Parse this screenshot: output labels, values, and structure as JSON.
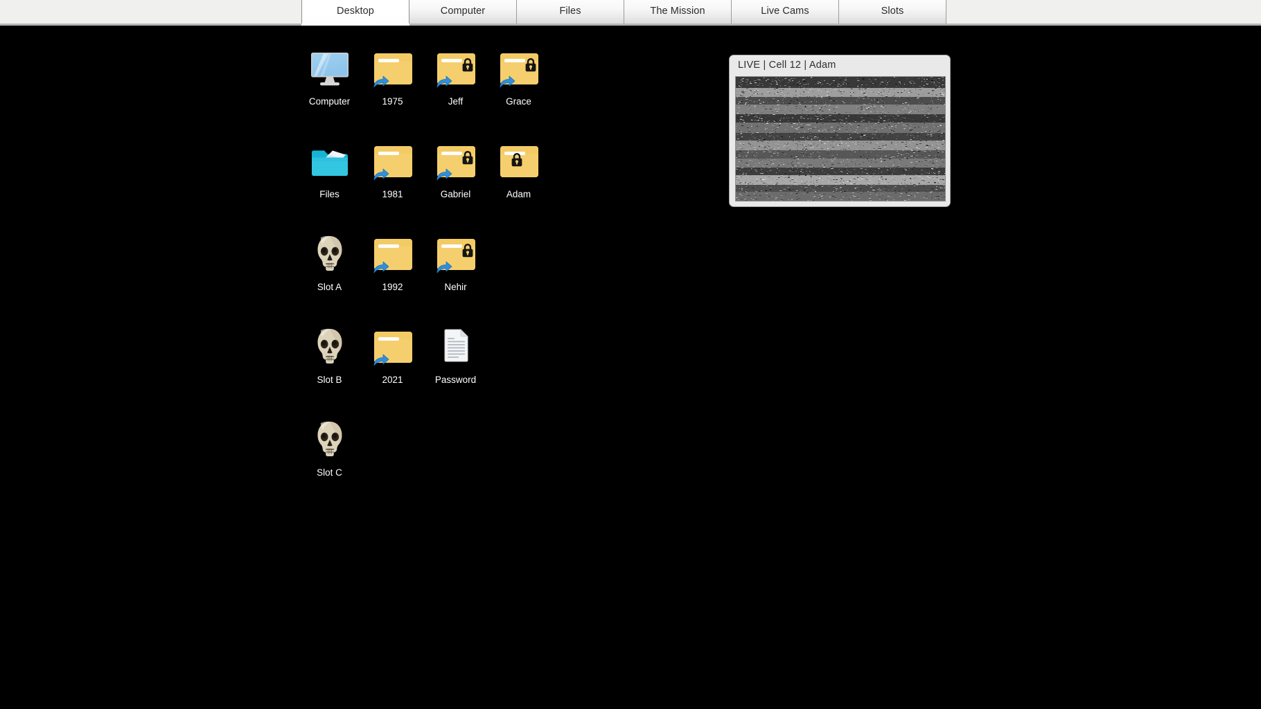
{
  "tabs": [
    {
      "label": "Desktop",
      "active": true
    },
    {
      "label": "Computer",
      "active": false
    },
    {
      "label": "Files",
      "active": false
    },
    {
      "label": "The Mission",
      "active": false
    },
    {
      "label": "Live Cams",
      "active": false
    },
    {
      "label": "Slots",
      "active": false
    }
  ],
  "desktop": {
    "background_color": "#000000",
    "label_color": "#ffffff",
    "rows": [
      [
        {
          "label": "Computer",
          "icon": "computer-monitor-icon",
          "type": "computer"
        },
        {
          "label": "1975",
          "icon": "folder-shortcut-icon",
          "type": "folder",
          "shortcut": true,
          "locked": false
        },
        {
          "label": "Jeff",
          "icon": "folder-shortcut-locked-icon",
          "type": "folder",
          "shortcut": true,
          "locked": true
        },
        {
          "label": "Grace",
          "icon": "folder-shortcut-locked-icon",
          "type": "folder",
          "shortcut": true,
          "locked": true
        }
      ],
      [
        {
          "label": "Files",
          "icon": "open-folder-icon",
          "type": "openfolder"
        },
        {
          "label": "1981",
          "icon": "folder-shortcut-icon",
          "type": "folder",
          "shortcut": true,
          "locked": false
        },
        {
          "label": "Gabriel",
          "icon": "folder-shortcut-locked-icon",
          "type": "folder",
          "shortcut": true,
          "locked": true
        },
        {
          "label": "Adam",
          "icon": "folder-locked-icon",
          "type": "folder",
          "shortcut": false,
          "locked": true
        }
      ],
      [
        {
          "label": "Slot A",
          "icon": "skull-icon",
          "type": "skull"
        },
        {
          "label": "1992",
          "icon": "folder-shortcut-icon",
          "type": "folder",
          "shortcut": true,
          "locked": false
        },
        {
          "label": "Nehir",
          "icon": "folder-shortcut-locked-icon",
          "type": "folder",
          "shortcut": true,
          "locked": true
        },
        {
          "label": "",
          "icon": "",
          "type": "empty"
        }
      ],
      [
        {
          "label": "Slot B",
          "icon": "skull-icon",
          "type": "skull"
        },
        {
          "label": "2021",
          "icon": "folder-shortcut-icon",
          "type": "folder",
          "shortcut": true,
          "locked": false
        },
        {
          "label": "Password",
          "icon": "document-icon",
          "type": "document"
        },
        {
          "label": "",
          "icon": "",
          "type": "empty"
        }
      ],
      [
        {
          "label": "Slot C",
          "icon": "skull-icon",
          "type": "skull"
        },
        {
          "label": "",
          "icon": "",
          "type": "empty"
        },
        {
          "label": "",
          "icon": "",
          "type": "empty"
        },
        {
          "label": "",
          "icon": "",
          "type": "empty"
        }
      ]
    ]
  },
  "livecam": {
    "title": "LIVE | Cell 12 | Adam",
    "status": "LIVE",
    "cell": "Cell 12",
    "subject": "Adam",
    "feed": "grayscale-static-noise",
    "panel_color": "#e9e9e9"
  }
}
